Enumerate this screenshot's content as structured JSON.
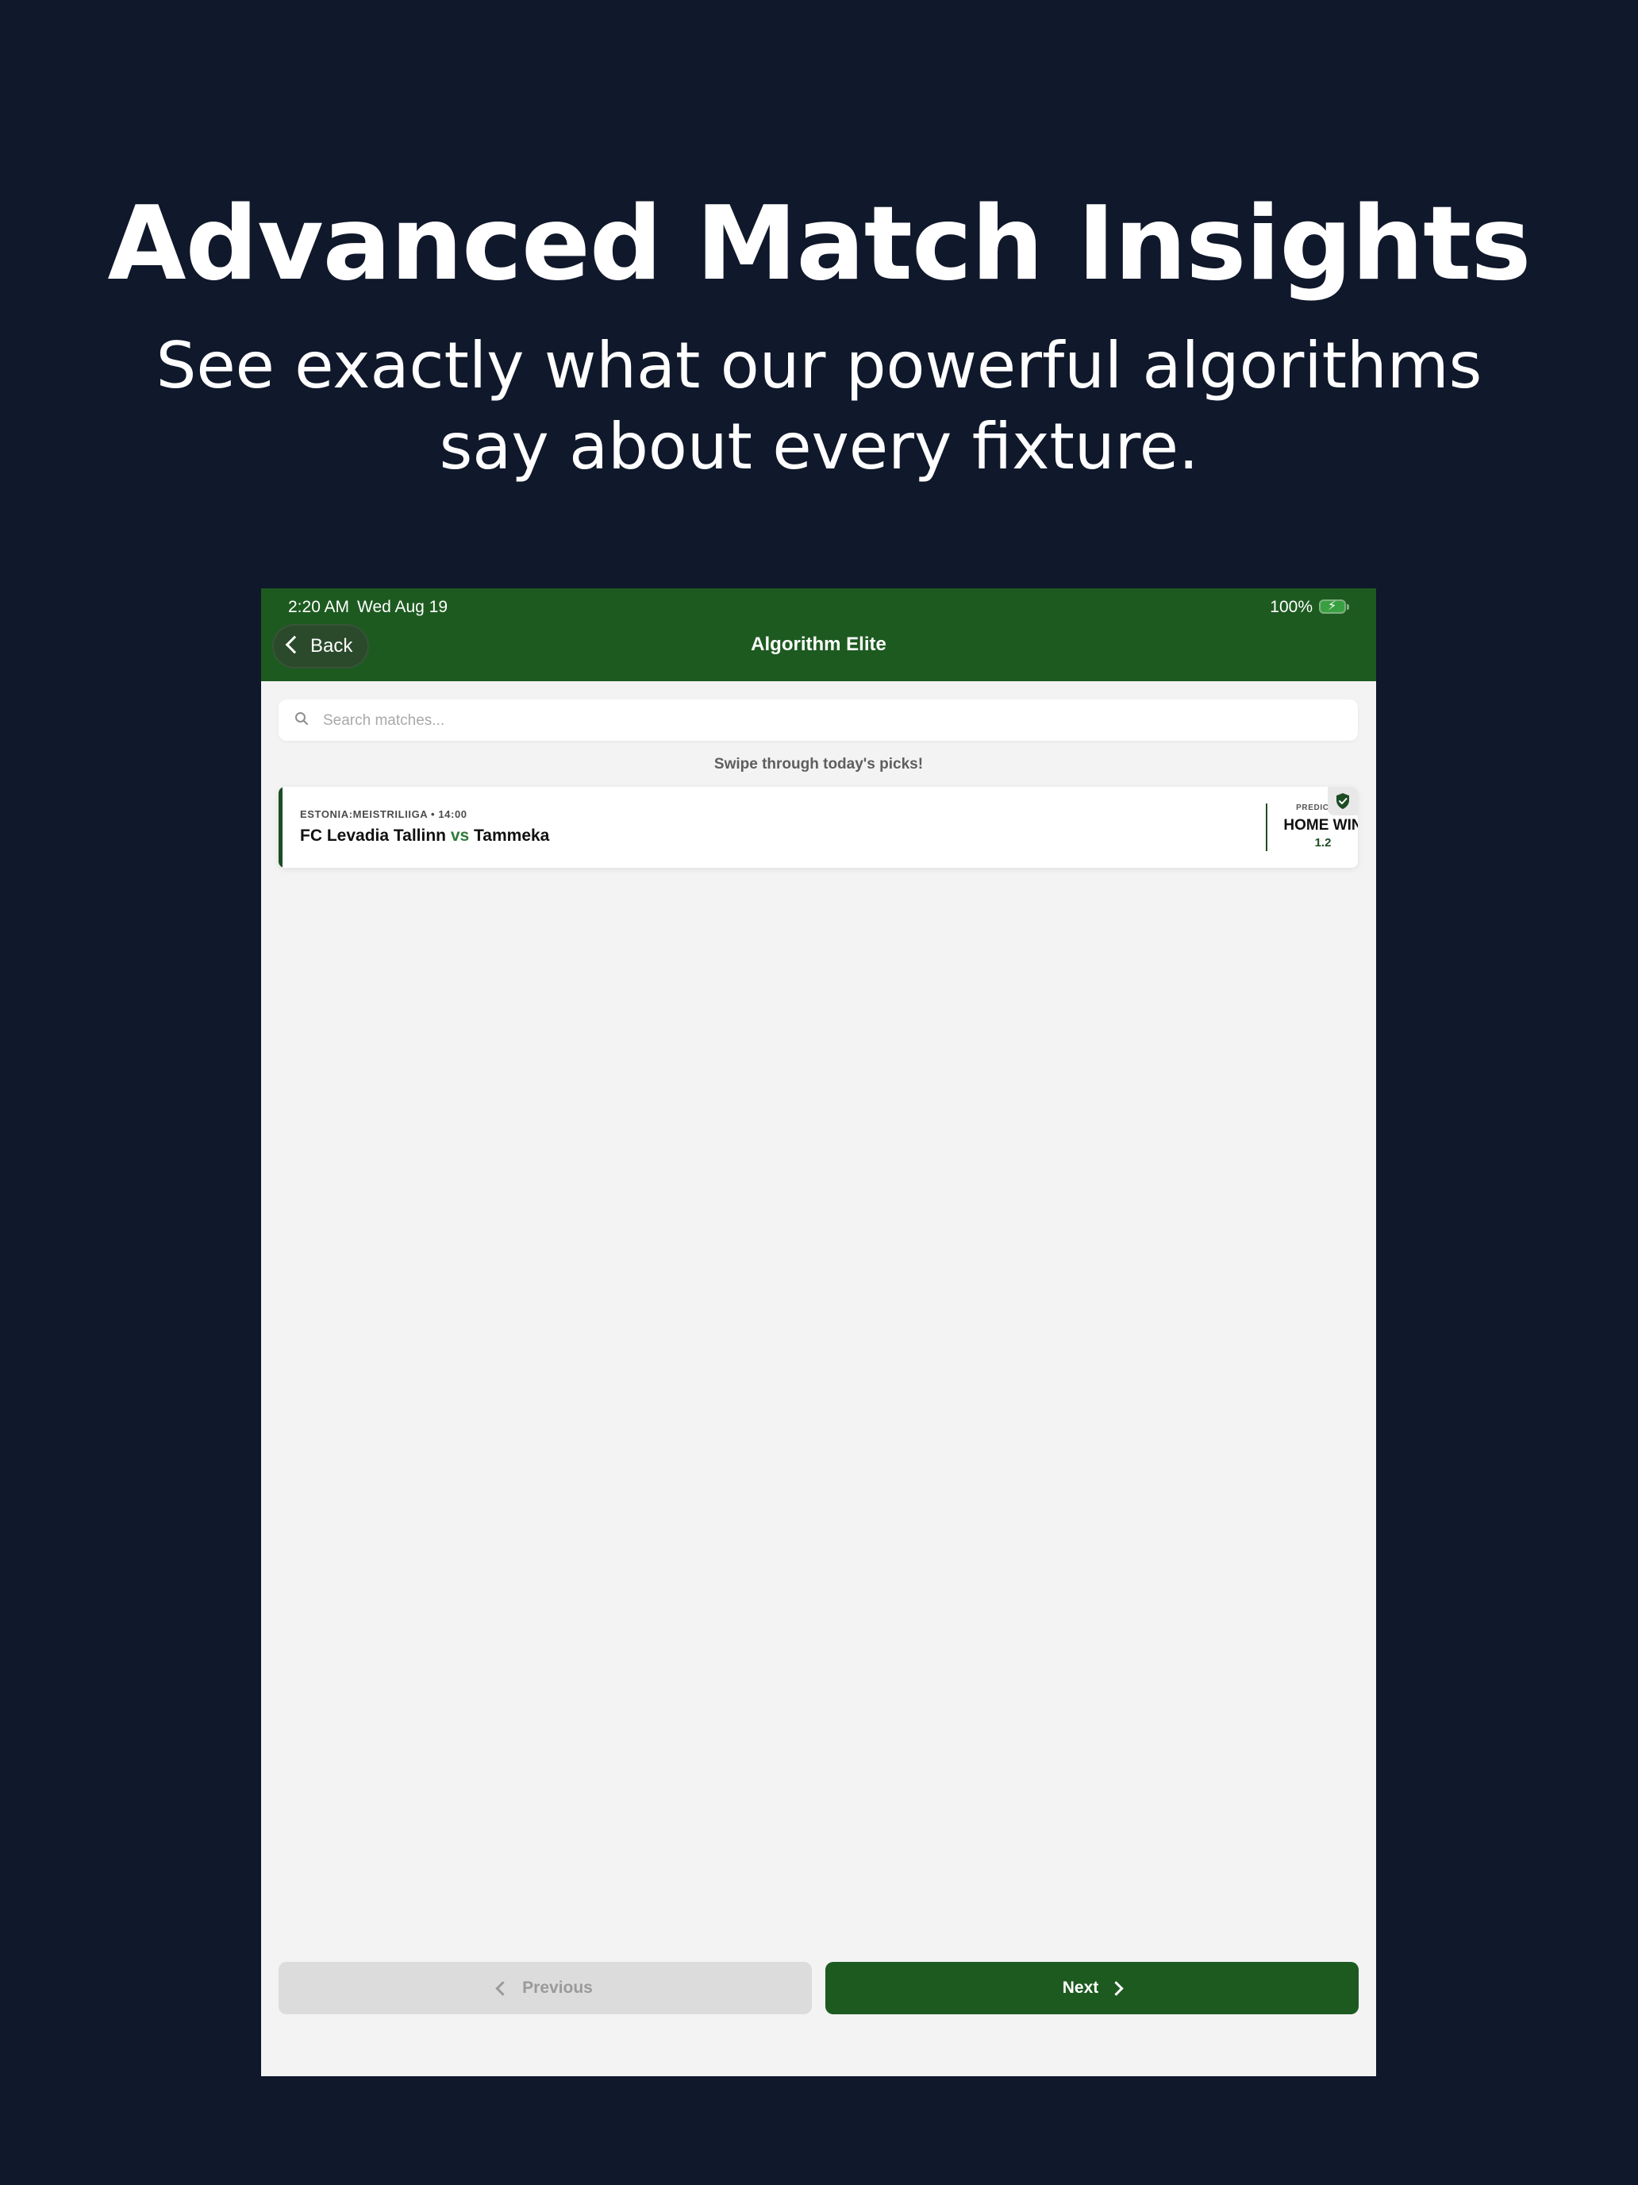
{
  "hero": {
    "title": "Advanced Match Insights",
    "subtitle": "See exactly what our powerful algorithms say about every fixture."
  },
  "status_bar": {
    "time": "2:20 AM",
    "date": "Wed Aug 19",
    "battery": "100%",
    "battery_icon": "battery-charging-icon"
  },
  "nav": {
    "back_label": "Back",
    "back_icon": "chevron-left-icon",
    "title": "Algorithm Elite"
  },
  "search": {
    "placeholder": "Search matches...",
    "value": "",
    "icon": "search-icon"
  },
  "hint": "Swipe through today's picks!",
  "matches": [
    {
      "league": "ESTONIA:MEISTRILIIGA • 14:00",
      "home_team": "FC Levadia Tallinn",
      "vs": "vs",
      "away_team": "Tammeka",
      "prediction_label": "PREDICTION",
      "prediction": "HOME WIN",
      "odds": "1.2",
      "badge_icon": "shield-check-icon"
    }
  ],
  "footer": {
    "previous_label": "Previous",
    "next_label": "Next",
    "previous_enabled": false,
    "next_enabled": true
  },
  "colors": {
    "background": "#10182b",
    "brand_green": "#1d5a20",
    "accent_dark_green": "#1d4d25",
    "vs_green": "#2f7b3b",
    "screen_bg": "#f3f3f3",
    "disabled_button": "#dcdcdc"
  }
}
